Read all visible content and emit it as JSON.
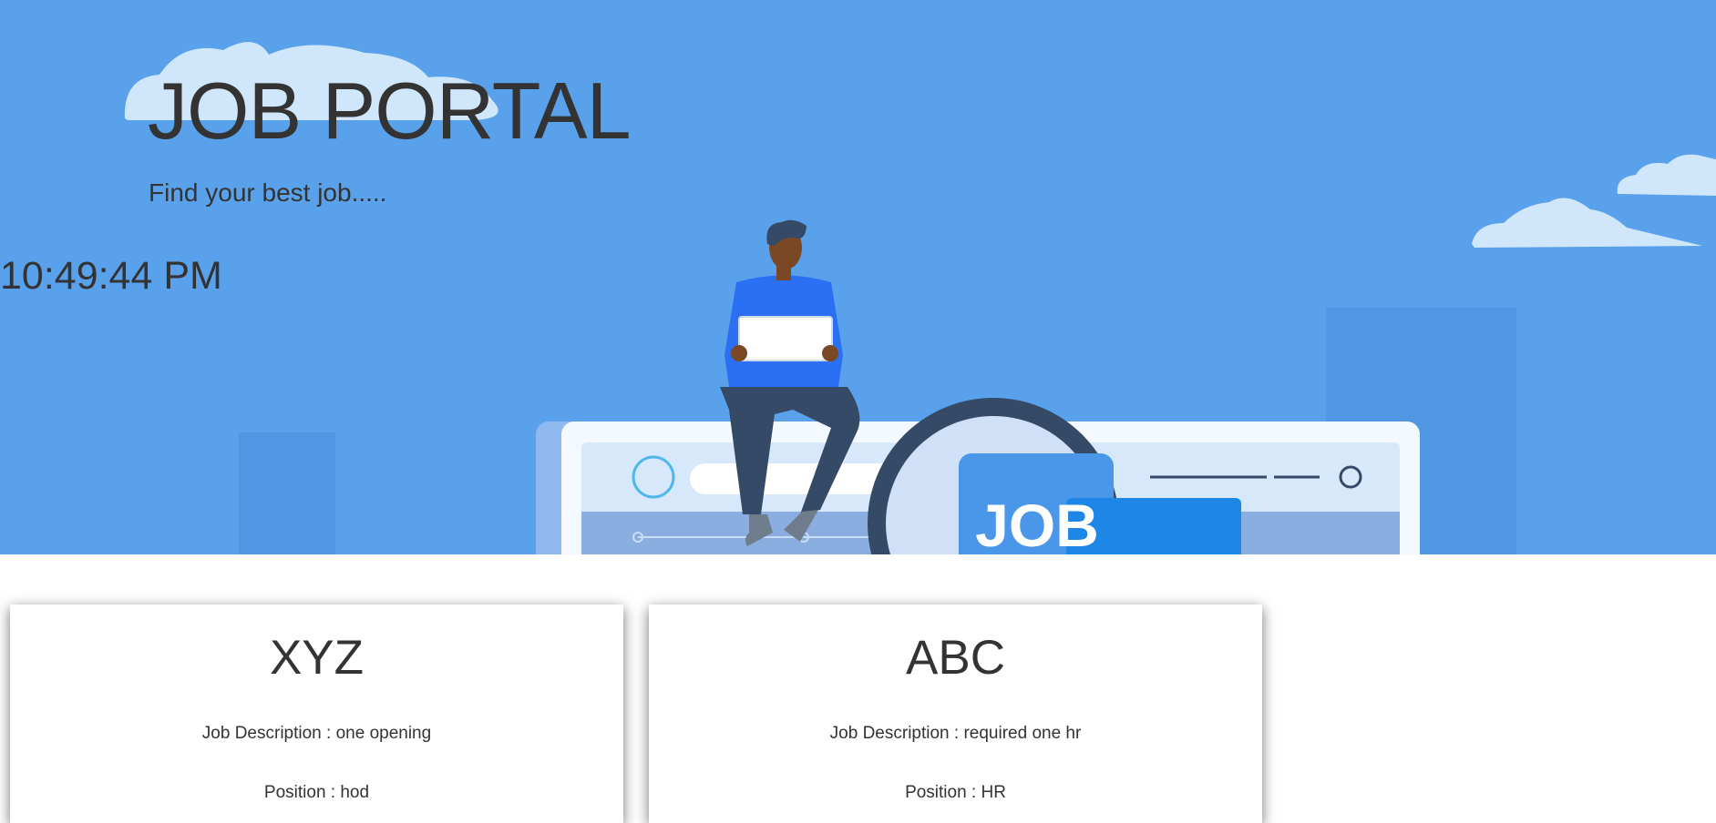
{
  "hero": {
    "title": "JOB PORTAL",
    "subtitle": "Find your best job.....",
    "clock": "10:49:44 PM",
    "illustration_label": "JOB",
    "colors": {
      "background": "#5aa1eb",
      "cloud": "#cfe6fb",
      "panel": "#d7e8fb",
      "person_shirt": "#2b6ff2",
      "person_pants": "#354a66",
      "magnifier_ring": "#354a66",
      "job_card": "#4a97ea"
    }
  },
  "jobs": [
    {
      "company": "XYZ",
      "description": "Job Description : one opening",
      "position": "Position : hod"
    },
    {
      "company": "ABC",
      "description": "Job Description : required one hr",
      "position": "Position : HR"
    }
  ]
}
